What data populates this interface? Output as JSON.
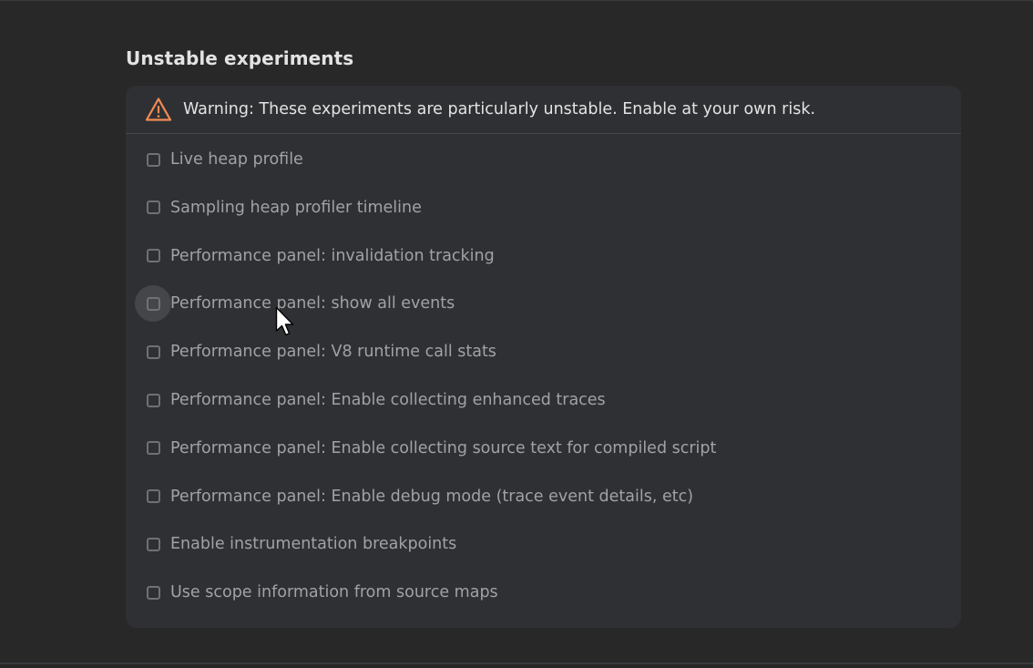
{
  "section": {
    "title": "Unstable experiments"
  },
  "warning": {
    "icon": "warning-triangle-icon",
    "icon_color": "#f28b54",
    "text": "Warning: These experiments are particularly unstable. Enable at your own risk."
  },
  "experiments": [
    {
      "label": "Live heap profile",
      "checked": false
    },
    {
      "label": "Sampling heap profiler timeline",
      "checked": false
    },
    {
      "label": "Performance panel: invalidation tracking",
      "checked": false
    },
    {
      "label": "Performance panel: show all events",
      "checked": false,
      "hovered": true
    },
    {
      "label": "Performance panel: V8 runtime call stats",
      "checked": false
    },
    {
      "label": "Performance panel: Enable collecting enhanced traces",
      "checked": false
    },
    {
      "label": "Performance panel: Enable collecting source text for compiled script",
      "checked": false
    },
    {
      "label": "Performance panel: Enable debug mode (trace event details, etc)",
      "checked": false
    },
    {
      "label": "Enable instrumentation breakpoints",
      "checked": false
    },
    {
      "label": "Use scope information from source maps",
      "checked": false
    }
  ],
  "colors": {
    "background": "#282828",
    "card": "#2f3033",
    "text_primary": "#e3e3e3",
    "text_secondary": "#a1a2a4"
  }
}
